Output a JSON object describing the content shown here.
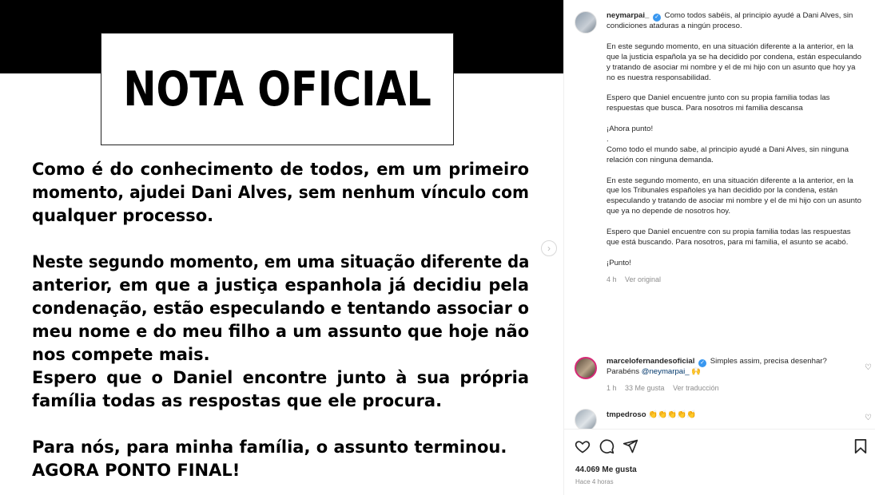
{
  "post_image": {
    "title": "NOTA  OFICIAL",
    "lines_p1": [
      "Como é do conhecimento de todos,  em um primeiro",
      "momento, ajudei Dani Alves, sem nenhum vínculo com",
      "qualquer processo."
    ],
    "lines_p2": [
      "Neste segundo momento, em uma situação diferente da",
      "anterior, em que a justiça espanhola já decidiu pela",
      "condenação, estão especulando e tentando associar o",
      "meu nome e do meu filho a um assunto que hoje não",
      "nos compete mais.",
      "Espero que o Daniel encontre junto à sua própria",
      "família todas as respostas que ele procura."
    ],
    "lines_p3": [
      "Para nós, para minha família, o assunto terminou.",
      "AGORA PONTO FINAL!"
    ]
  },
  "caption": {
    "username": "neymarpai_",
    "first": "Como todos sabéis, al principio ayudé a Dani Alves, sin condiciones ataduras a ningún proceso.",
    "p2": "En este segundo momento, en una situación diferente a la anterior, en la que la justicia española ya se ha decidido por condena, están especulando y tratando de asociar mi nombre y el de mi hijo con un asunto que hoy ya no es nuestra responsabilidad.",
    "p3": "Espero que Daniel encuentre junto con su propia familia todas las respuestas que busca. Para nosotros mi familia descansa",
    "p4": "¡Ahora punto!",
    "dot": ".",
    "p5": "Como todo el mundo sabe, al principio ayudé a Dani Alves, sin ninguna relación con ninguna demanda.",
    "p6": "En este segundo momento, en una situación diferente a la anterior, en la que los Tribunales españoles ya han decidido por la condena, están especulando y tratando de asociar mi nombre y el de mi hijo con un asunto que ya no depende de nosotros hoy.",
    "p7": "Espero que Daniel encuentre con su propia familia todas las respuestas que está buscando. Para nosotros, para mi familia, el asunto se acabó.",
    "p8": "¡Punto!",
    "time": "4 h",
    "see_original": "Ver original"
  },
  "comments": [
    {
      "username": "marcelofernandesoficial",
      "text": "Simples assim, precisa desenhar? Parabéns ",
      "mention": "@neymarpai_",
      "emoji": "🙌",
      "time": "1 h",
      "likes": "33 Me gusta",
      "translate": "Ver traducción"
    },
    {
      "username": "tmpedroso",
      "emoji": "👏👏👏👏👏"
    }
  ],
  "actions": {
    "likes": "44.069 Me gusta",
    "posted": "Hace 4 horas"
  },
  "icons": {
    "heart": "heart-icon",
    "comment": "comment-icon",
    "share": "share-icon",
    "save": "bookmark-icon",
    "next": "chevron-right-icon"
  },
  "colors": {
    "verified": "#3897f0",
    "muted": "#8e8e8e",
    "text": "#262626"
  }
}
